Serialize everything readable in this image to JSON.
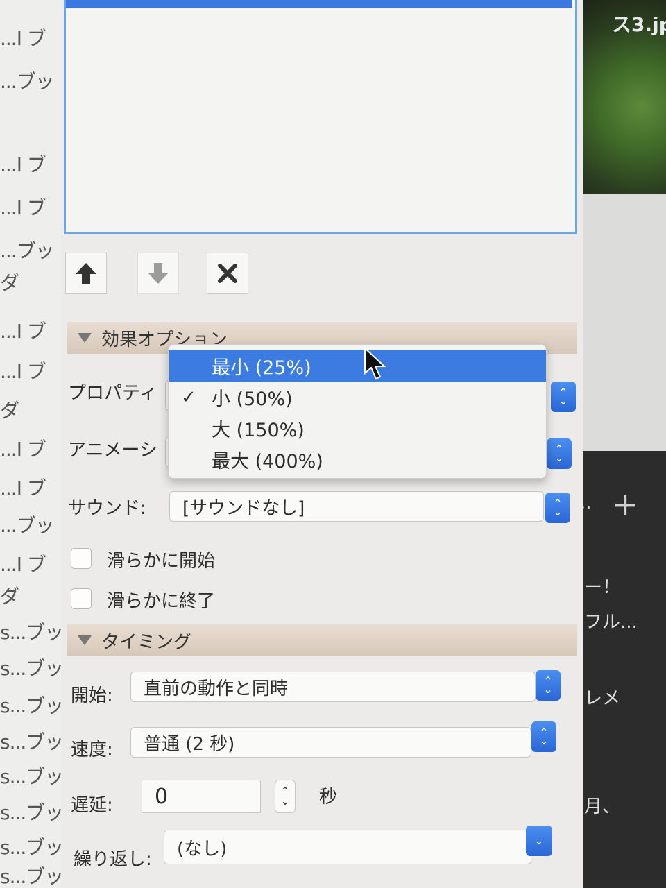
{
  "left_list": {
    "items": [
      "...I ブ",
      "...ブッ",
      "...I ブ",
      "...I ブ",
      "...ブッ",
      "ダ",
      "...I ブ",
      "...I ブ",
      "ダ",
      "...I ブ",
      "...I ブ",
      "...ブッ",
      "...I ブ",
      "ダ",
      "s...ブッ",
      "s...ブッ",
      "s...ブッ",
      "s...ブッ",
      "s...ブッ",
      "s...ブッ",
      "s...ブッ",
      "s...ブッ"
    ]
  },
  "toolbar": {
    "up_icon": "arrow-up-icon",
    "down_icon": "arrow-down-icon",
    "delete_icon": "close-icon"
  },
  "effect_options": {
    "header": "効果オプション",
    "property_label": "プロパティ",
    "animation_label": "アニメーシ",
    "sound_label": "サウンド:",
    "sound_value": "[サウンドなし]",
    "smooth_start_label": "滑らかに開始",
    "smooth_end_label": "滑らかに終了"
  },
  "menu": {
    "items": [
      {
        "label": "最小 (25%)",
        "highlighted": true,
        "checked": false
      },
      {
        "label": "小 (50%)",
        "highlighted": false,
        "checked": true
      },
      {
        "label": "大 (150%)",
        "highlighted": false,
        "checked": false
      },
      {
        "label": "最大 (400%)",
        "highlighted": false,
        "checked": false
      }
    ],
    "check_mark": "✓"
  },
  "timing": {
    "header": "タイミング",
    "start_label": "開始:",
    "start_value": "直前の動作と同時",
    "speed_label": "速度:",
    "speed_value": "普通 (2 秒)",
    "delay_label": "遅延:",
    "delay_value": "0",
    "delay_unit": "秒",
    "repeat_label": "繰り返し:",
    "repeat_value": "(なし)"
  },
  "right_side": {
    "photo_caption": "ス3.jp",
    "add_label": "+",
    "ellipsis": "..",
    "text1": "ー！",
    "text2": "フル...",
    "text3": "レメ",
    "text4": "月、"
  },
  "colors": {
    "accent": "#3c7be0",
    "section_header": "#dccfc2",
    "panel": "#ecebea"
  }
}
